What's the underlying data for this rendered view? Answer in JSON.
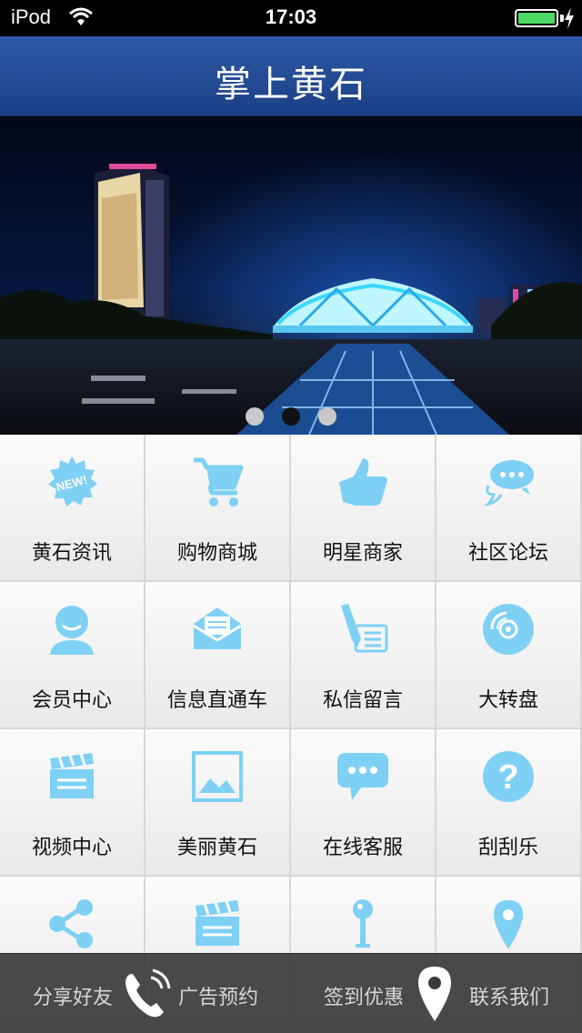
{
  "status_bar": {
    "carrier": "iPod",
    "time": "17:03",
    "battery_level": 1.0
  },
  "header": {
    "title": "掌上黄石"
  },
  "banner": {
    "slide_count": 3,
    "active_index": 1
  },
  "grid": {
    "items": [
      {
        "label": "黄石资讯",
        "icon": "new-badge-icon"
      },
      {
        "label": "购物商城",
        "icon": "shopping-cart-icon"
      },
      {
        "label": "明星商家",
        "icon": "thumbs-up-icon"
      },
      {
        "label": "社区论坛",
        "icon": "chat-bubbles-icon"
      },
      {
        "label": "会员中心",
        "icon": "user-icon"
      },
      {
        "label": "信息直通车",
        "icon": "envelope-icon"
      },
      {
        "label": "私信留言",
        "icon": "pen-note-icon"
      },
      {
        "label": "大转盘",
        "icon": "disc-icon"
      },
      {
        "label": "视频中心",
        "icon": "clapperboard-icon"
      },
      {
        "label": "美丽黄石",
        "icon": "image-icon"
      },
      {
        "label": "在线客服",
        "icon": "speech-bubble-icon"
      },
      {
        "label": "刮刮乐",
        "icon": "question-icon"
      },
      {
        "label": "",
        "icon": "share-icon"
      },
      {
        "label": "",
        "icon": "clapperboard-icon"
      },
      {
        "label": "",
        "icon": "pushpin-icon"
      },
      {
        "label": "",
        "icon": "map-pin-icon"
      }
    ]
  },
  "bottom_bar": {
    "items": [
      {
        "label": "分享好友"
      },
      {
        "label": "广告预约"
      },
      {
        "label": "签到优惠"
      },
      {
        "label": "联系我们"
      }
    ],
    "overlay_icons": [
      "phone-icon",
      "location-pin-icon"
    ]
  },
  "colors": {
    "header": "#2f5aa6",
    "icon": "#7fd0f5",
    "tile": "#f2f2f2",
    "bottom_bar": "#3c3c3c"
  }
}
